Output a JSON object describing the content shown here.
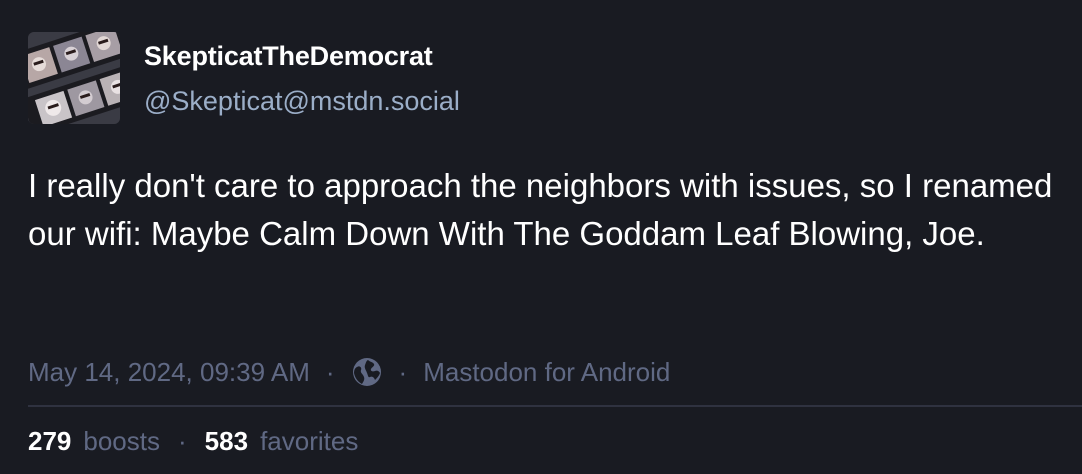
{
  "account": {
    "display_name": "SkepticatTheDemocrat",
    "handle": "@Skepticat@mstdn.social",
    "avatar_icon": "avatar-photo"
  },
  "post": {
    "text": "I really don't care to approach the neighbors with issues, so I renamed our wifi: Maybe Calm Down With The Goddam Leaf Blowing, Joe."
  },
  "meta": {
    "timestamp": "May 14, 2024, 09:39 AM",
    "separator": "·",
    "visibility_icon": "globe-icon",
    "application": "Mastodon for Android"
  },
  "stats": {
    "boosts_count": "279",
    "boosts_label": "boosts",
    "favorites_count": "583",
    "favorites_label": "favorites",
    "separator": "·"
  },
  "colors": {
    "background": "#191b22",
    "primary_text": "#ffffff",
    "handle_text": "#9baec8",
    "muted_text": "#606984",
    "divider": "#2f3240"
  }
}
